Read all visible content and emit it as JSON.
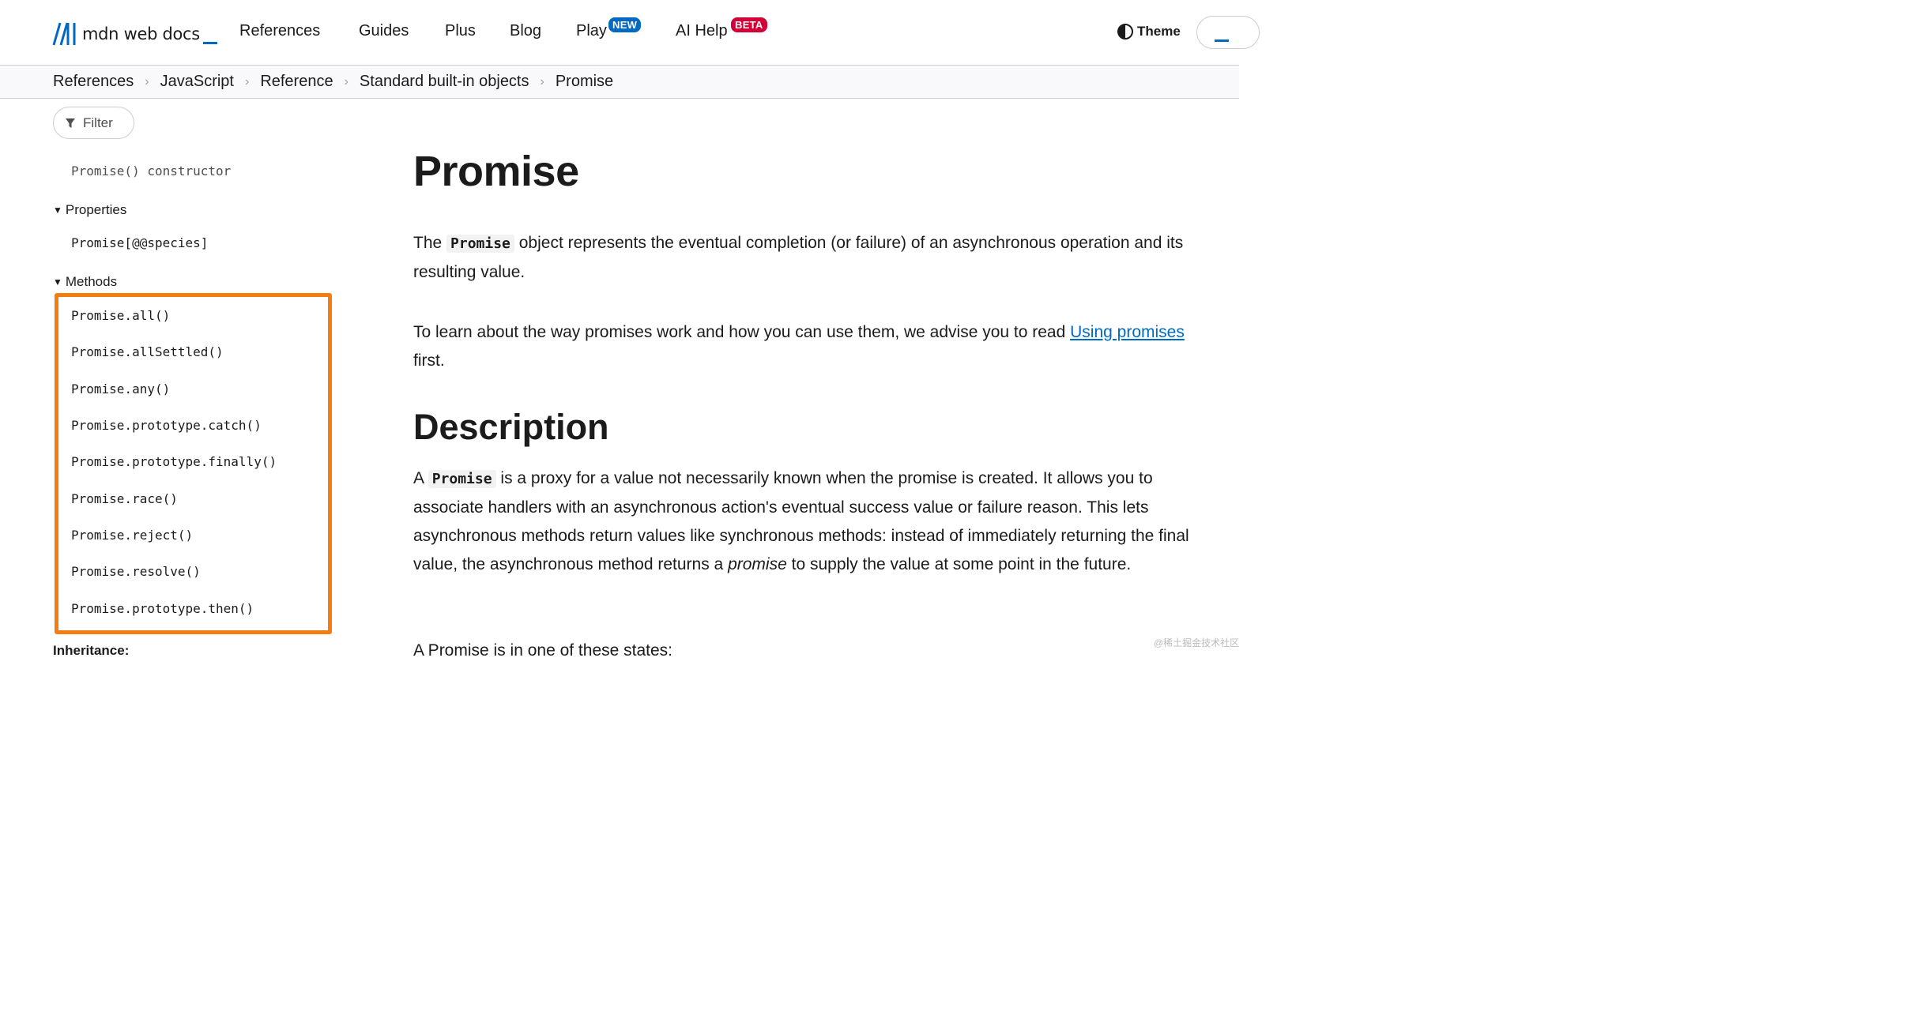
{
  "header": {
    "logo_text": "mdn web docs",
    "nav": [
      "References",
      "Guides",
      "Plus",
      "Blog",
      "Play",
      "AI Help"
    ],
    "badges": {
      "play": "NEW",
      "ai_help": "BETA"
    },
    "theme_label": "Theme"
  },
  "breadcrumb": [
    "References",
    "JavaScript",
    "Reference",
    "Standard built-in objects",
    "Promise"
  ],
  "sidebar": {
    "filter_label": "Filter",
    "constructor": "Promise() constructor",
    "properties_heading": "Properties",
    "properties": [
      "Promise[@@species]"
    ],
    "methods_heading": "Methods",
    "methods": [
      "Promise.all()",
      "Promise.allSettled()",
      "Promise.any()",
      "Promise.prototype.catch()",
      "Promise.prototype.finally()",
      "Promise.race()",
      "Promise.reject()",
      "Promise.resolve()",
      "Promise.prototype.then()"
    ],
    "next_heading_partial": "Inheritance:"
  },
  "article": {
    "title": "Promise",
    "intro": {
      "before": "The",
      "code": "Promise",
      "after": "object represents the eventual completion (or failure) of an asynchronous operation and its resulting value."
    },
    "learn": {
      "before": "To learn about the way promises work and how you can use them, we advise you to read",
      "link": "Using promises",
      "after": "first."
    },
    "description_heading": "Description",
    "description": {
      "before": "A",
      "code": "Promise",
      "middle": "is a proxy for a value not necessarily known when the promise is created. It allows you to associate handlers with an asynchronous action's eventual success value or failure reason. This lets asynchronous methods return values like synchronous methods: instead of immediately returning the final value, the asynchronous method returns a",
      "em": "promise",
      "after": "to supply the value at some point in the future."
    },
    "states_partial": "A Promise is in one of these states:"
  },
  "watermark": "@稀土掘金技术社区",
  "colors": {
    "accent": "#0069c2",
    "highlight": "#f57d10",
    "beta": "#d30038"
  }
}
